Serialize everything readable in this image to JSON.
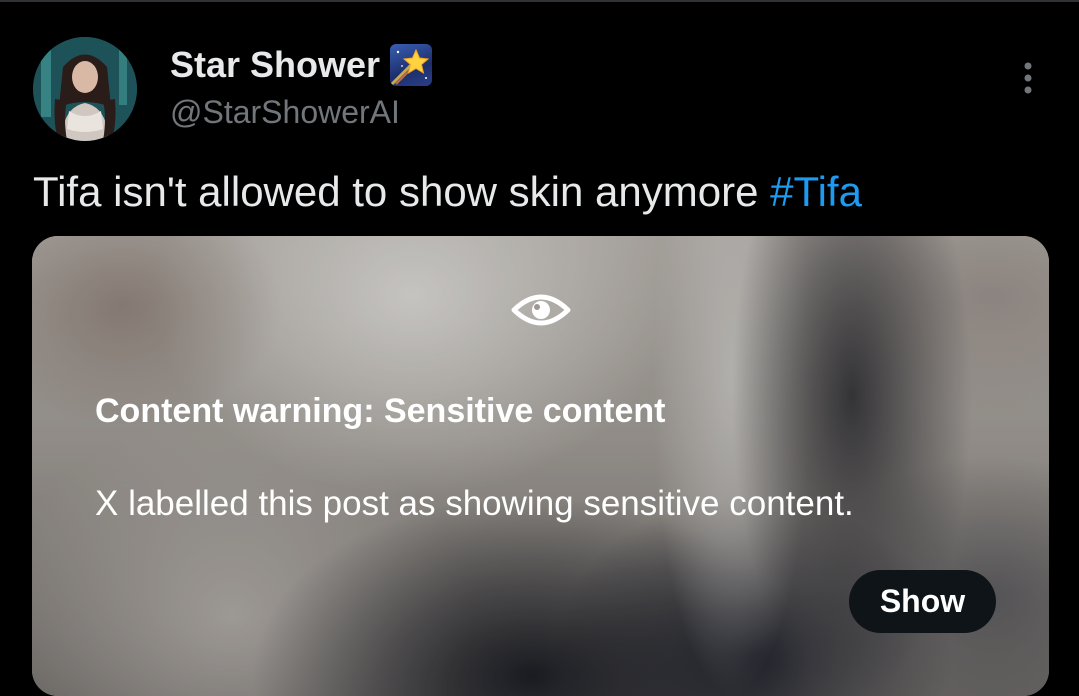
{
  "post": {
    "author": {
      "display_name": "Star Shower",
      "badge_emoji": "shooting-star-emoji",
      "handle": "@StarShowerAI",
      "avatar": "avatar-image"
    },
    "text": "Tifa isn't allowed to show skin anymore ",
    "hashtag": "#Tifa",
    "more_icon": "more-vertical-icon"
  },
  "media": {
    "warning_icon": "eye-icon",
    "warning_title": "Content warning: Sensitive content",
    "warning_description": "X labelled this post as showing sensitive content.",
    "show_label": "Show"
  },
  "colors": {
    "background": "#000000",
    "text_primary": "#e7e9ea",
    "text_secondary": "#71767b",
    "link": "#1d9bf0",
    "button_bg": "#0f1419"
  }
}
